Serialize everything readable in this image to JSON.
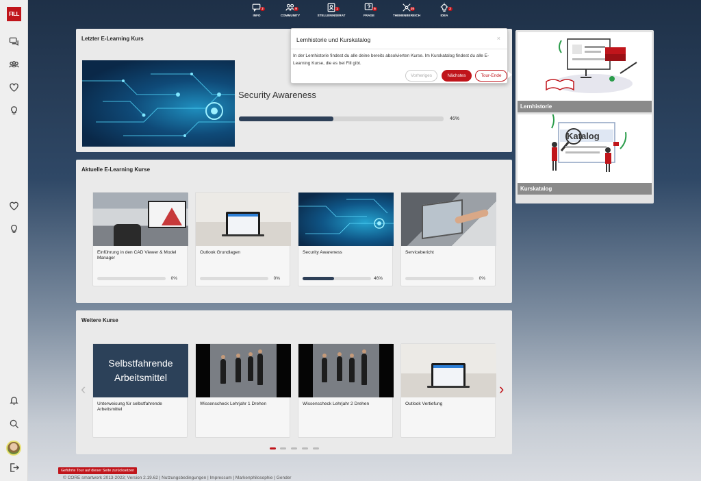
{
  "brand": {
    "logo_text": "FILL",
    "accent_color": "#c0151b"
  },
  "topnav": [
    {
      "label": "INFO",
      "badge": "2",
      "icon": "chat-icon"
    },
    {
      "label": "COMMUNITY",
      "badge": "9",
      "icon": "people-icon"
    },
    {
      "label": "STELLENINSERAT",
      "badge": "1",
      "icon": "job-icon"
    },
    {
      "label": "FRAGE",
      "badge": "5",
      "icon": "question-icon"
    },
    {
      "label": "THEMENBEREICH",
      "badge": "20",
      "icon": "topics-icon"
    },
    {
      "label": "IDEA",
      "badge": "2",
      "icon": "lightbulb-icon"
    }
  ],
  "last_course": {
    "heading": "Letzter E-Learning Kurs",
    "title": "Security Awareness",
    "progress_pct": "46%",
    "progress_value": 46
  },
  "current_courses": {
    "heading": "Aktuelle E-Learning Kurse",
    "items": [
      {
        "title": "Einführung in den CAD Viewer & Model Manager",
        "pct": "0%",
        "progress": 0
      },
      {
        "title": "Outlook Grundlagen",
        "pct": "0%",
        "progress": 0
      },
      {
        "title": "Security Awareness",
        "pct": "46%",
        "progress": 46
      },
      {
        "title": "Servicebericht",
        "pct": "0%",
        "progress": 0
      }
    ]
  },
  "more_courses": {
    "heading": "Weitere Kurse",
    "items": [
      {
        "title": "Unterweisung für selbstfahrende Arbeitsmittel",
        "thumb_text": "Selbstfahrende Arbeitsmittel"
      },
      {
        "title": "Wissenscheck Lehrjahr 1 Drehen"
      },
      {
        "title": "Wissenscheck Lehrjahr 2 Drehen"
      },
      {
        "title": "Outlook Vertiefung"
      }
    ],
    "prev_arrow": "‹",
    "next_arrow": "›"
  },
  "tour": {
    "title": "Lernhistorie und Kurskatalog",
    "close": "×",
    "body": "In der Lernhistorie findest du alle deine bereits absolvierten Kurse. Im Kurskatalog findest du alle E-Learning Kurse, die es bei Fill gibt.",
    "prev_label": "Vorheriges",
    "next_label": "Nächstes",
    "end_label": "Tour-Ende"
  },
  "side_tiles": {
    "history_label": "Lernhistorie",
    "catalog_label": "Kurskatalog",
    "catalog_word": "Katalog"
  },
  "footer": {
    "reset_tour": "Geführte Tour auf dieser Seite zurücksetzen",
    "copyright": "© CORE smartwork 2013-2023; Version 2.19.62 | Nutzungsbedingungen | Impressum | Markenphilosophie | Gender"
  }
}
